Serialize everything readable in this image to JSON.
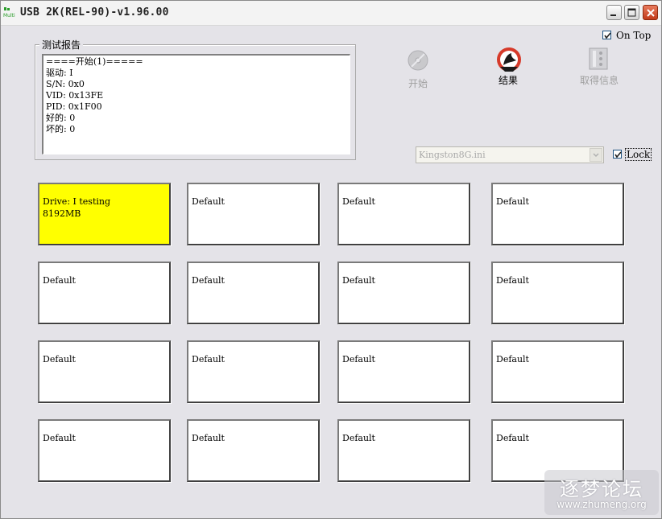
{
  "window": {
    "title": "USB 2K(REL-90)-v1.96.00",
    "app_icon_text": "Multi"
  },
  "report": {
    "legend": "测试报告",
    "lines": [
      "====开始(1)=====",
      "驱动: I",
      "S/N: 0x0",
      "VID: 0x13FE",
      "PID: 0x1F00",
      "好的: 0",
      "坏的: 0"
    ]
  },
  "on_top": {
    "label": "On Top",
    "checked": true
  },
  "toolbar": {
    "start_label": "开始",
    "start_enabled": false,
    "result_label": "结果",
    "result_enabled": true,
    "info_label": "取得信息",
    "info_enabled": false
  },
  "config": {
    "selected": "Kingston8G.ini",
    "enabled": false
  },
  "lock": {
    "label": "Lock",
    "checked": true
  },
  "drives": [
    {
      "line1": "Drive: I  testing",
      "line2": "8192MB",
      "status": "testing",
      "color": "#ffff00"
    },
    {
      "line1": "Default",
      "line2": ""
    },
    {
      "line1": "Default",
      "line2": ""
    },
    {
      "line1": "Default",
      "line2": ""
    },
    {
      "line1": "Default",
      "line2": ""
    },
    {
      "line1": "Default",
      "line2": ""
    },
    {
      "line1": "Default",
      "line2": ""
    },
    {
      "line1": "Default",
      "line2": ""
    },
    {
      "line1": "Default",
      "line2": ""
    },
    {
      "line1": "Default",
      "line2": ""
    },
    {
      "line1": "Default",
      "line2": ""
    },
    {
      "line1": "Default",
      "line2": ""
    },
    {
      "line1": "Default",
      "line2": ""
    },
    {
      "line1": "Default",
      "line2": ""
    },
    {
      "line1": "Default",
      "line2": ""
    },
    {
      "line1": "Default",
      "line2": ""
    }
  ],
  "watermark": {
    "line1": "逐梦论坛",
    "line2": "www.zhumeng.org"
  }
}
